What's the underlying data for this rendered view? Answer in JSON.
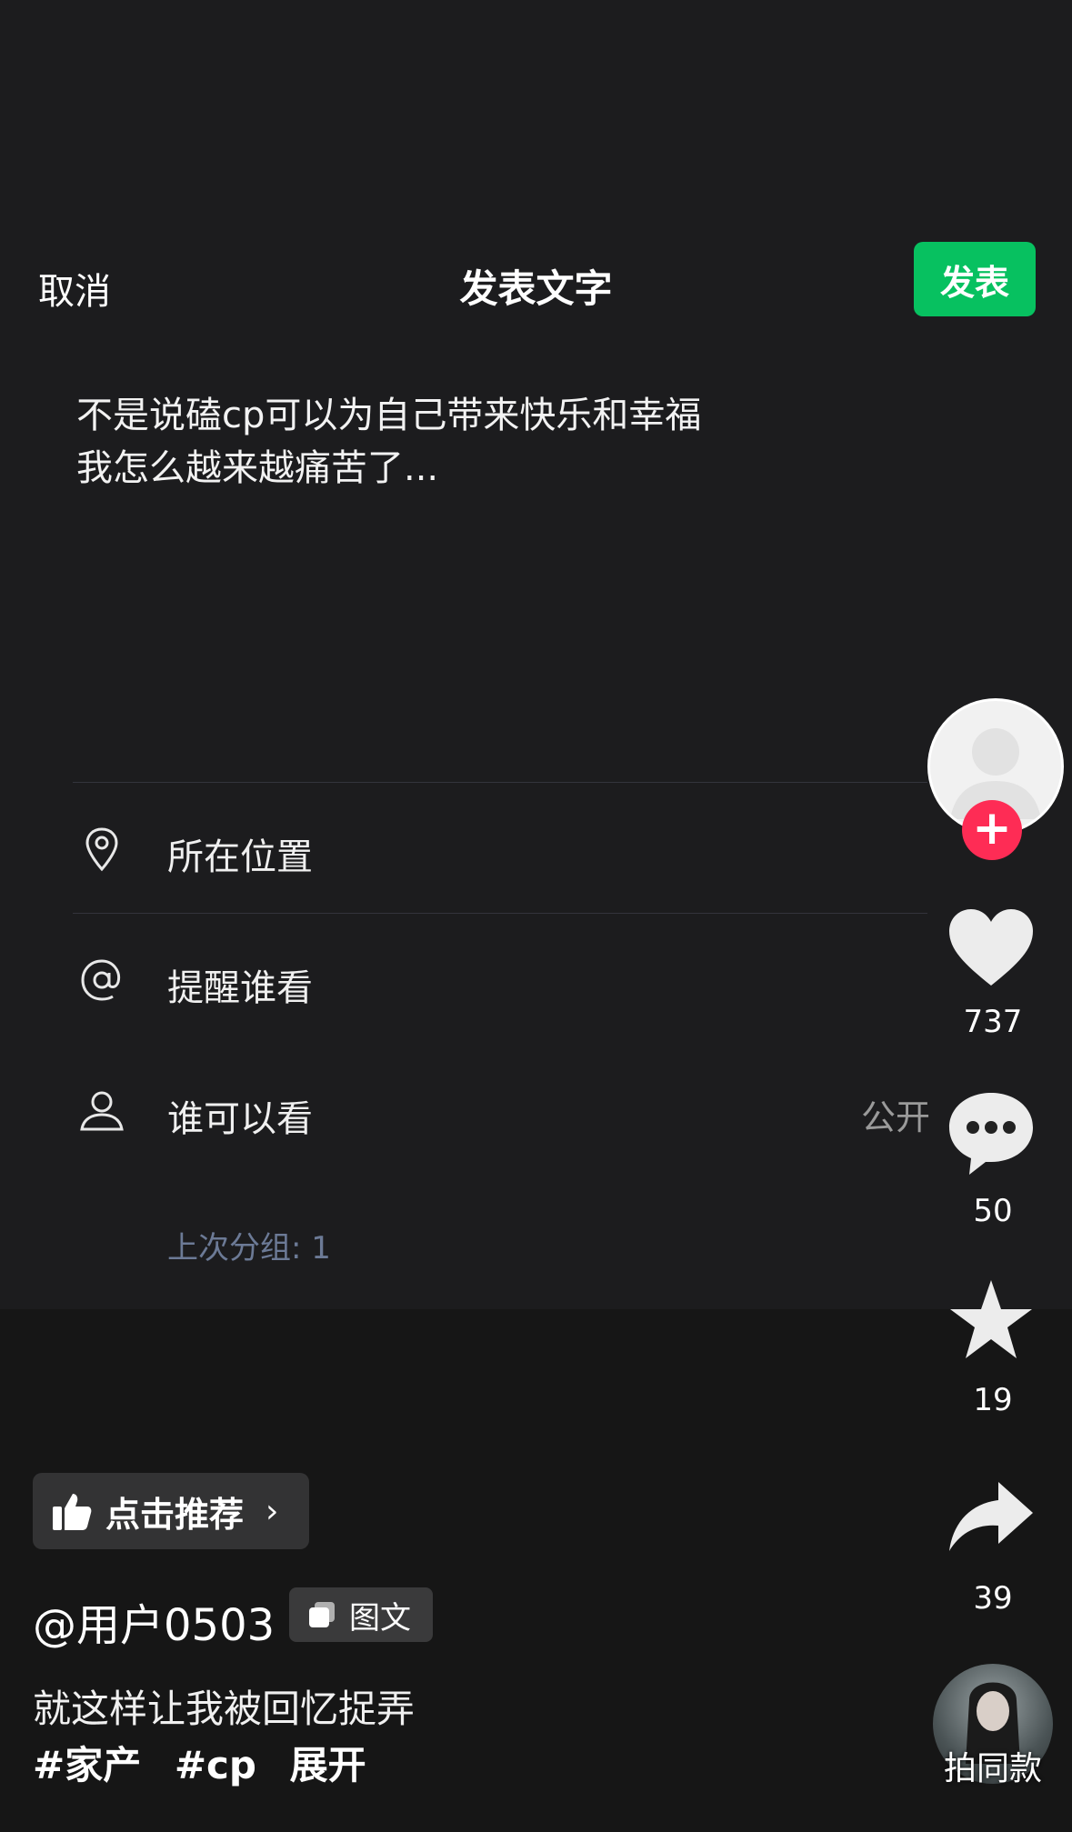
{
  "header": {
    "cancel_label": "取消",
    "title": "发表文字",
    "publish_label": "发表"
  },
  "post": {
    "text": "不是说磕cp可以为自己带来快乐和幸福\n我怎么越来越痛苦了..."
  },
  "options": [
    {
      "icon": "location-pin-icon",
      "label": "所在位置",
      "value": ""
    },
    {
      "icon": "at-icon",
      "label": "提醒谁看",
      "value": ""
    },
    {
      "icon": "person-icon",
      "label": "谁可以看",
      "value": "公开"
    }
  ],
  "last_group": "上次分组: 1",
  "rail": {
    "likes": "737",
    "comments": "50",
    "favorites": "19",
    "shares": "39",
    "same_style_label": "拍同款"
  },
  "recommend": {
    "label": "点击推荐",
    "chevron": "›"
  },
  "author": {
    "username": "@用户0503",
    "badge": "图文"
  },
  "caption": "就这样让我被回忆捉弄",
  "tags": [
    "#家产",
    "#cp"
  ],
  "expand_label": "展开",
  "colors": {
    "publish_green": "#07c160",
    "follow_red": "#fe2c55",
    "background": "#1c1c1e"
  }
}
